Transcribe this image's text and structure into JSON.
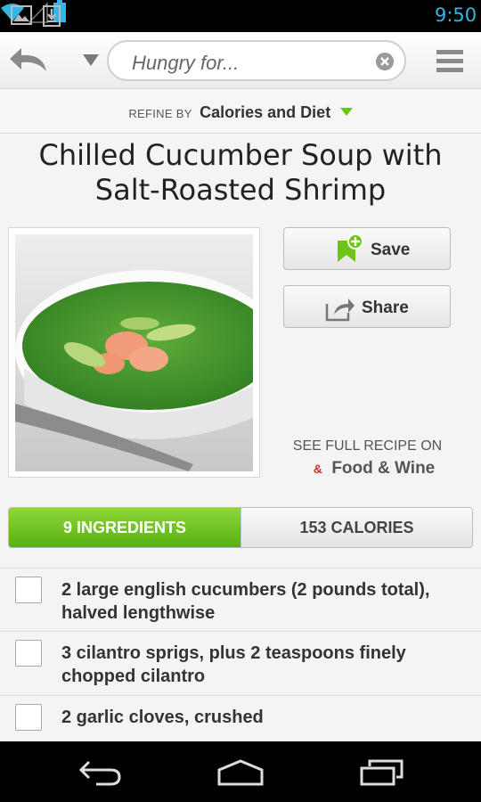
{
  "status_bar": {
    "time": "9:50",
    "icons": [
      "gallery-icon",
      "download-icon",
      "wifi-icon",
      "signal-icon",
      "battery-icon"
    ],
    "time_color": "#33b5e5"
  },
  "app_bar": {
    "back_icon": "back-arrow-icon",
    "dropdown_icon": "triangle-down-icon",
    "search": {
      "value": "Hungry for...",
      "clear_icon": "clear-icon"
    },
    "menu_icon": "menu-icon"
  },
  "refine": {
    "prefix": "REFINE BY",
    "value": "Calories and Diet",
    "accent": "#6cc417"
  },
  "recipe": {
    "title": "Chilled Cucumber Soup with Salt-Roasted Shrimp",
    "photo_alt": "soup-photo",
    "save_label": "Save",
    "share_label": "Share",
    "see_full_label": "SEE FULL RECIPE ON",
    "source_mark": "&",
    "source_name": "Food & Wine"
  },
  "tabs": {
    "ingredients_label": "9 INGREDIENTS",
    "calories_label": "153 CALORIES",
    "active": "ingredients",
    "active_color": "#6cc417"
  },
  "ingredients": [
    {
      "text": "2 large english cucumbers (2 pounds total), halved lengthwise",
      "checked": false
    },
    {
      "text": "3 cilantro sprigs, plus 2 teaspoons finely chopped cilantro",
      "checked": false
    },
    {
      "text": "2 garlic cloves, crushed",
      "checked": false
    }
  ],
  "nav_bar": {
    "icons": [
      "nav-back-icon",
      "nav-home-icon",
      "nav-recent-icon"
    ]
  }
}
